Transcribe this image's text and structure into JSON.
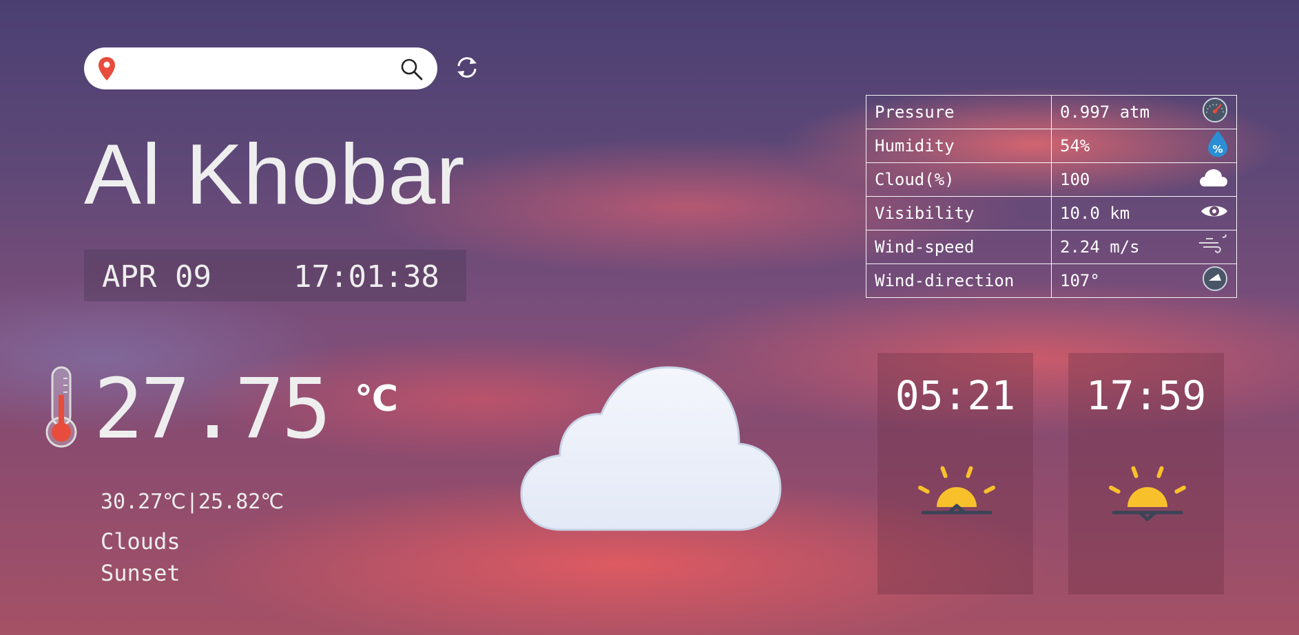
{
  "search": {
    "placeholder": "",
    "value": "",
    "location_icon": "map-pin-icon",
    "search_icon": "search-icon",
    "refresh_icon": "refresh-icon"
  },
  "location": {
    "city": "Al Khobar"
  },
  "datetime": {
    "date": "APR 09",
    "time": "17:01:38"
  },
  "current": {
    "temperature": "27.75",
    "unit": "℃",
    "max_min": "30.27℃|25.82℃",
    "condition": "Clouds",
    "period": "Sunset",
    "thermometer_icon": "thermometer-icon",
    "condition_icon": "cloud-icon"
  },
  "details": [
    {
      "label": "Pressure",
      "value": "0.997 atm",
      "icon": "gauge-icon"
    },
    {
      "label": "Humidity",
      "value": "54%",
      "icon": "humidity-drop-icon"
    },
    {
      "label": "Cloud(%)",
      "value": "100",
      "icon": "cloud-icon"
    },
    {
      "label": "Visibility",
      "value": "10.0 km",
      "icon": "eye-icon"
    },
    {
      "label": "Wind-speed",
      "value": "2.24 m/s",
      "icon": "wind-icon"
    },
    {
      "label": "Wind-direction",
      "value": "107°",
      "icon": "compass-icon"
    }
  ],
  "sun": {
    "sunrise": {
      "time": "05:21",
      "icon": "sunrise-icon"
    },
    "sunset": {
      "time": "17:59",
      "icon": "sunset-icon"
    }
  },
  "colors": {
    "accent_red": "#e74c3c",
    "cloud_fill": "#eef2fb",
    "sun_yellow": "#f8c12c"
  }
}
